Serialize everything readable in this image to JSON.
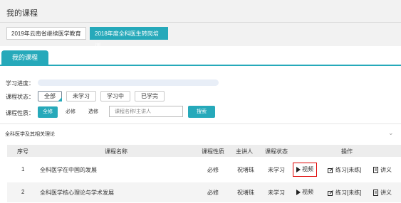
{
  "page": {
    "title": "我的课程"
  },
  "course_tabs": [
    {
      "label": "2019年云南省继续医学教育",
      "active": false
    },
    {
      "label": "2018年度全科医生转岗培训",
      "active": true
    }
  ],
  "panel_tab": {
    "label": "我的课程"
  },
  "filters": {
    "progress_label": "学习进度：",
    "progress_value": 0,
    "status_label": "课程状态：",
    "status_options": [
      "全部",
      "未学习",
      "学习中",
      "已学完"
    ],
    "status_selected": "全部",
    "nature_label": "课程性质：",
    "nature_options": [
      "全修",
      "必修",
      "选修"
    ],
    "nature_selected": "全修",
    "search_placeholder": "课程名称/主讲人",
    "search_button": "搜索"
  },
  "section": {
    "title": "全科医学及其相关理论"
  },
  "table": {
    "headers": [
      "序号",
      "课程名称",
      "课程性质",
      "主讲人",
      "课程状态",
      "操作"
    ],
    "rows": [
      {
        "index": "1",
        "name": "全科医学在中国的发展",
        "nature": "必修",
        "lecturer": "祝墡珠",
        "status": "未学习",
        "video": "视频",
        "practice": "练习[未练]",
        "notes": "讲义"
      },
      {
        "index": "2",
        "name": "全科医学核心理论与学术发展",
        "nature": "必修",
        "lecturer": "祝墡珠",
        "status": "未学习",
        "video": "视频",
        "practice": "练习[未练]",
        "notes": "讲义"
      }
    ]
  },
  "colors": {
    "accent": "#26a9ba",
    "highlight": "#e00000"
  }
}
